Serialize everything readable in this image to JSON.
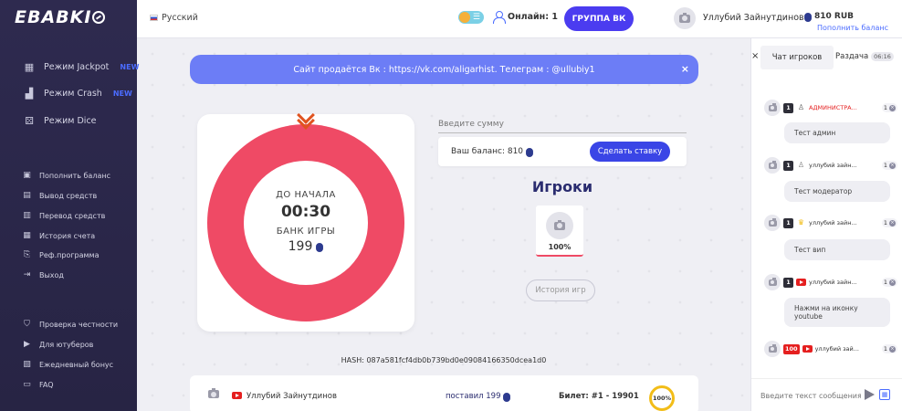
{
  "logo": {
    "text": "EBABKI"
  },
  "sidebar": {
    "modes": [
      {
        "label": "Режим Jackpot",
        "badge": "NEW",
        "icon": "grid-icon"
      },
      {
        "label": "Режим Crash",
        "badge": "NEW",
        "icon": "chart-icon"
      },
      {
        "label": "Режим Dice",
        "badge": "",
        "icon": "dice-icon"
      }
    ],
    "account": [
      {
        "label": "Пополнить баланс",
        "icon": "wallet-icon"
      },
      {
        "label": "Вывод средств",
        "icon": "withdraw-icon"
      },
      {
        "label": "Перевод средств",
        "icon": "transfer-icon"
      },
      {
        "label": "История счета",
        "icon": "history-icon"
      },
      {
        "label": "Реф.программа",
        "icon": "referral-icon"
      },
      {
        "label": "Выход",
        "icon": "logout-icon"
      }
    ],
    "info": [
      {
        "label": "Проверка честности",
        "icon": "shield-icon"
      },
      {
        "label": "Для ютуберов",
        "icon": "youtube-icon"
      },
      {
        "label": "Ежедневный бонус",
        "icon": "gift-icon"
      },
      {
        "label": "FAQ",
        "icon": "faq-icon"
      }
    ]
  },
  "header": {
    "language": "Русский",
    "online_label": "Онлайн: 1",
    "vk_button": "ГРУППА ВК",
    "user_name": "Уллубий Зайнутдинов",
    "balance": "810 RUB",
    "topup_link": "Пополнить баланс"
  },
  "banner": {
    "text": "Сайт продаётся Вк : https://vk.com/aligarhist. Телеграм : @ullubiy1",
    "close": "×"
  },
  "game": {
    "start_label": "ДО НАЧАЛА",
    "timer": "00:30",
    "bank_label": "БАНК ИГРЫ",
    "bank_value": "199"
  },
  "bet": {
    "input_placeholder": "Введите сумму",
    "balance_label": "Ваш баланс: 810",
    "make_bet": "Сделать ставку"
  },
  "players": {
    "title": "Игроки",
    "items": [
      {
        "percent": "100%"
      }
    ]
  },
  "history_button": "История игр",
  "hash": "HASH: 087a581fcf4db0b739bd0e09084166350dcea1d0",
  "bet_row": {
    "user": "Уллубий Зайнутдинов",
    "amount": "поставил 199",
    "ticket": "Билет: #1 - 19901",
    "percent": "100%"
  },
  "chat": {
    "close": "×",
    "tab_chat": "Чат игроков",
    "tab_giveaway": "Раздача",
    "giveaway_timer": "06:16",
    "messages": [
      {
        "level": "1",
        "role": "admin",
        "name": "АДМИНИСТРА...",
        "count": "1",
        "text": "Тест админ"
      },
      {
        "level": "1",
        "role": "mod",
        "name": "уллубий зайн...",
        "count": "1",
        "text": "Тест модератор"
      },
      {
        "level": "1",
        "role": "vip",
        "name": "уллубий зайн...",
        "count": "1",
        "text": "Тест вип"
      },
      {
        "level": "1",
        "role": "yt",
        "name": "уллубий зайн...",
        "count": "1",
        "text": "Нажми на иконку youtube"
      },
      {
        "level": "100",
        "role": "yt",
        "name": "уллубий зай...",
        "count": "1",
        "text": ""
      }
    ],
    "input_placeholder": "Введите текст сообщения"
  }
}
